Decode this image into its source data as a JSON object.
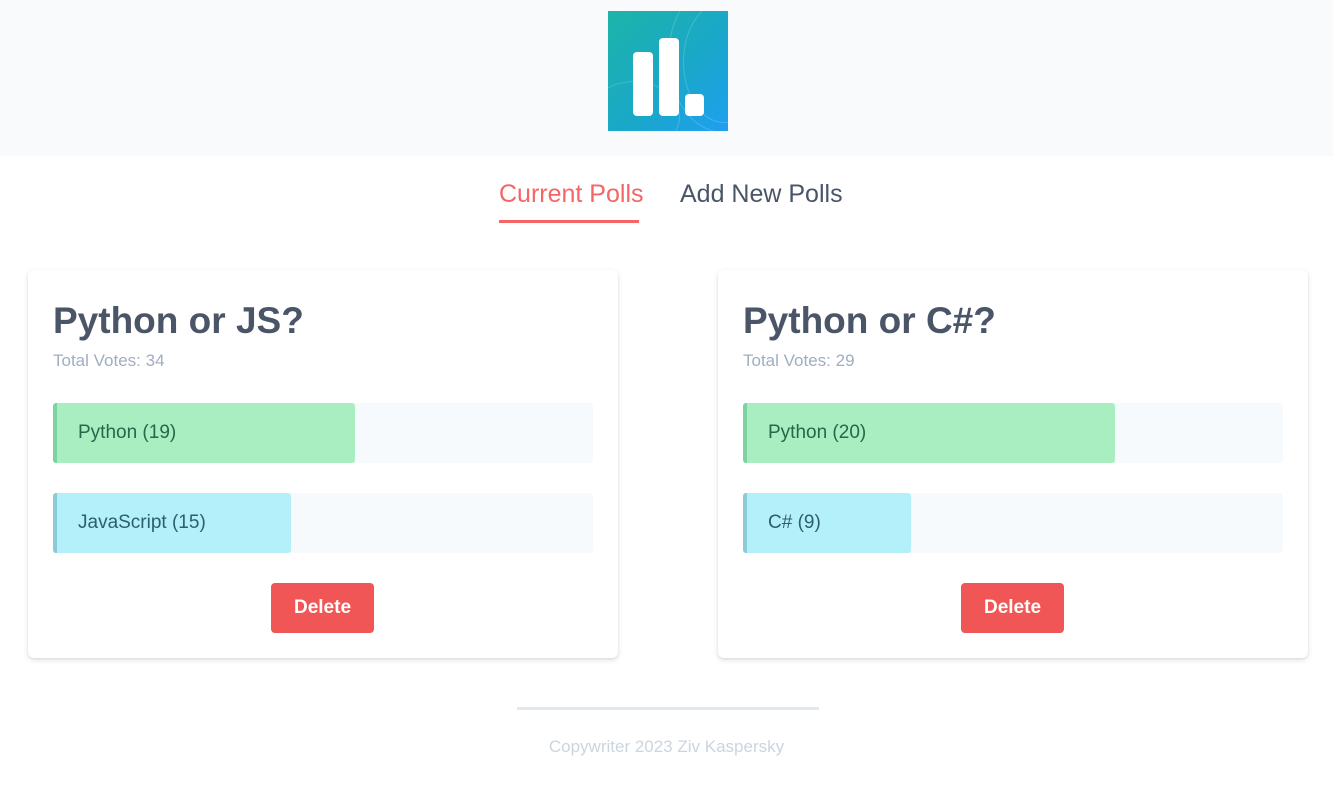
{
  "header": {
    "logo_icon": "bar-chart-logo-icon"
  },
  "nav": {
    "tabs": [
      {
        "label": "Current Polls",
        "active": true
      },
      {
        "label": "Add New Polls",
        "active": false
      }
    ],
    "active_color": "#f56565"
  },
  "polls": [
    {
      "question": "Python or JS?",
      "total_votes": "Total Votes: 34",
      "options": [
        {
          "label": "Python (19)",
          "votes": 19,
          "color": "#a9eec1"
        },
        {
          "label": "JavaScript (15)",
          "votes": 15,
          "color": "#b4f0f9"
        }
      ],
      "delete_label": "Delete"
    },
    {
      "question": "Python or C#?",
      "total_votes": "Total Votes: 29",
      "options": [
        {
          "label": "Python (20)",
          "votes": 20,
          "color": "#a9eec1"
        },
        {
          "label": "C# (9)",
          "votes": 9,
          "color": "#b4f0f9"
        }
      ],
      "delete_label": "Delete"
    }
  ],
  "footer": {
    "text": "Copywriter 2023 Ziv Kaspersky"
  }
}
